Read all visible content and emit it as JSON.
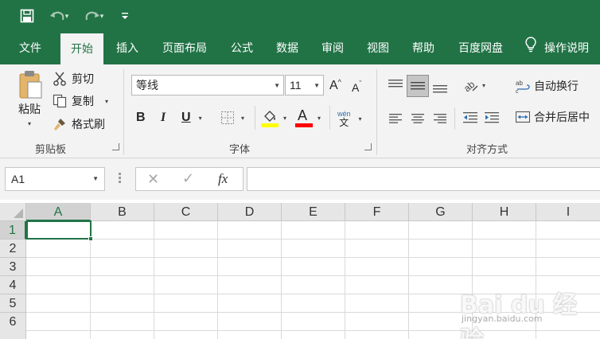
{
  "colors": {
    "accent": "#217346",
    "ribbon_bg": "#f3f3f3",
    "highlight_yellow": "#ffff00",
    "font_red": "#ff0000"
  },
  "quick_access": {
    "save_icon": "save-icon",
    "undo_icon": "undo-icon",
    "redo_icon": "redo-icon",
    "customize_icon": "customize-qat-icon"
  },
  "tabs": [
    {
      "label": "文件"
    },
    {
      "label": "开始",
      "active": true
    },
    {
      "label": "插入"
    },
    {
      "label": "页面布局"
    },
    {
      "label": "公式"
    },
    {
      "label": "数据"
    },
    {
      "label": "审阅"
    },
    {
      "label": "视图"
    },
    {
      "label": "帮助"
    },
    {
      "label": "百度网盘"
    }
  ],
  "tell_me": {
    "label": "操作说明"
  },
  "clipboard": {
    "paste_label": "粘贴",
    "cut_label": "剪切",
    "copy_label": "复制",
    "format_painter_label": "格式刷",
    "group_label": "剪贴板"
  },
  "font": {
    "font_name": "等线",
    "font_size": "11",
    "increase_size_glyph": "A",
    "decrease_size_glyph": "A",
    "bold": "B",
    "italic": "I",
    "underline": "U",
    "font_color_glyph": "A",
    "phonetic_top": "wén",
    "phonetic_bottom": "文",
    "group_label": "字体"
  },
  "alignment": {
    "wrap_text_label": "自动换行",
    "merge_center_label": "合并后居中",
    "group_label": "对齐方式"
  },
  "formula_bar": {
    "name_box": "A1",
    "cancel_glyph": "✕",
    "enter_glyph": "✓",
    "fx_glyph": "fx",
    "formula": ""
  },
  "grid": {
    "columns": [
      "A",
      "B",
      "C",
      "D",
      "E",
      "F",
      "G",
      "H",
      "I"
    ],
    "rows": [
      "1",
      "2",
      "3",
      "4",
      "5",
      "6"
    ],
    "active_cell": "A1"
  },
  "watermark": {
    "text": "Bai du 经验",
    "url_text": "jingyan.baidu.com"
  }
}
